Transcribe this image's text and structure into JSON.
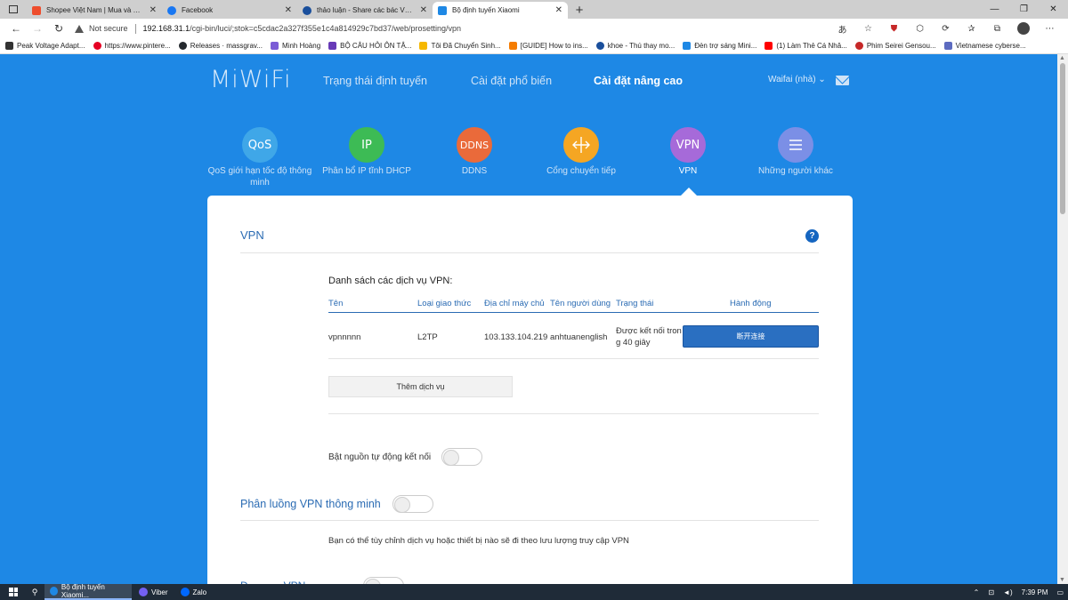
{
  "browser": {
    "tabs": [
      {
        "title": "Shopee Việt Nam | Mua và Bán T",
        "color": "#ee4d2d"
      },
      {
        "title": "Facebook",
        "color": "#1877f2"
      },
      {
        "title": "thảo luận - Share các bác VPN c",
        "color": "#1a4f9c"
      },
      {
        "title": "Bộ định tuyến Xiaomi",
        "color": "#1e88e5"
      }
    ],
    "security_label": "Not secure",
    "url_host": "192.168.31.1",
    "url_path": "/cgi-bin/luci/;stok=c5cdac2a327f355e1c4a814929c7bd37/web/prosetting/vpn",
    "bookmarks": [
      {
        "label": "Peak Voltage Adapt...",
        "color": "#333333"
      },
      {
        "label": "https://www.pintere...",
        "color": "#e60023"
      },
      {
        "label": "Releases · massgrav...",
        "color": "#24292e"
      },
      {
        "label": "Minh Hoàng",
        "color": "#7b5cd6"
      },
      {
        "label": "BỘ CÂU HỎI ÔN TẬ...",
        "color": "#673ab7"
      },
      {
        "label": "Tôi Đã Chuyển Sinh...",
        "color": "#f6b800"
      },
      {
        "label": "[GUIDE] How to ins...",
        "color": "#f57c00"
      },
      {
        "label": "khoe - Thú thay mo...",
        "color": "#1a4f9c"
      },
      {
        "label": "Đèn trợ sáng Mini...",
        "color": "#1e88e5"
      },
      {
        "label": "(1) Làm Thẻ Cá Nhâ...",
        "color": "#ff0000"
      },
      {
        "label": "Phim Seirei Gensou...",
        "color": "#c62828"
      },
      {
        "label": "Vietnamese cyberse...",
        "color": "#5c6bc0"
      }
    ]
  },
  "router": {
    "logo": "MiWiFi",
    "nav": [
      "Trạng thái định tuyến",
      "Cài đặt phổ biến",
      "Cài đặt nâng cao"
    ],
    "user": "Waifai (nhà)",
    "features": [
      {
        "icon": "QoS",
        "label": "QoS giới hạn tốc độ thông minh",
        "color": "#3fa7e8"
      },
      {
        "icon": "IP",
        "label": "Phân bổ IP tĩnh DHCP",
        "color": "#3dbb55"
      },
      {
        "icon": "DDNS",
        "label": "DDNS",
        "color": "#ea6a3a"
      },
      {
        "icon": "",
        "label": "Cổng chuyển tiếp",
        "color": "#f5a623"
      },
      {
        "icon": "VPN",
        "label": "VPN",
        "color": "#a66ad9"
      },
      {
        "icon": "",
        "label": "Những người khác",
        "color": "#7b8fe6"
      }
    ],
    "panel": {
      "title": "VPN",
      "help": "?",
      "list_title": "Danh sách các dịch vụ VPN:",
      "headers": [
        "Tên",
        "Loại giao thức",
        "Địa chỉ máy chủ",
        "Tên người dùng",
        "Trạng thái",
        "Hành động"
      ],
      "row": {
        "name": "vpnnnnn",
        "protocol": "L2TP",
        "server": "103.133.104.219",
        "username": "anhtuanenglish",
        "status": "Được kết nối trong 40 giây",
        "status_line1": "Được kết nối tron",
        "status_line2": "g 40 giây",
        "action": "断开连接"
      },
      "add_service": "Thêm dịch vụ",
      "auto_connect_label": "Bật nguồn tự động kết nối",
      "auto_connect_on": false,
      "smart_split_title": "Phân luồng VPN thông minh",
      "smart_split_on": false,
      "smart_split_desc": "Bạn có thể tùy chỉnh dịch vụ hoặc thiết bị nào sẽ đi theo lưu lượng truy cập VPN",
      "next_section_partial": "Đ... ... ... VPN"
    }
  },
  "taskbar": {
    "items": [
      {
        "label": "Bộ định tuyến Xiaomi...",
        "color": "#1e88e5"
      },
      {
        "label": "Viber",
        "color": "#7360f2"
      },
      {
        "label": "Zalo",
        "color": "#0068ff"
      }
    ],
    "time": "7:39 PM"
  }
}
